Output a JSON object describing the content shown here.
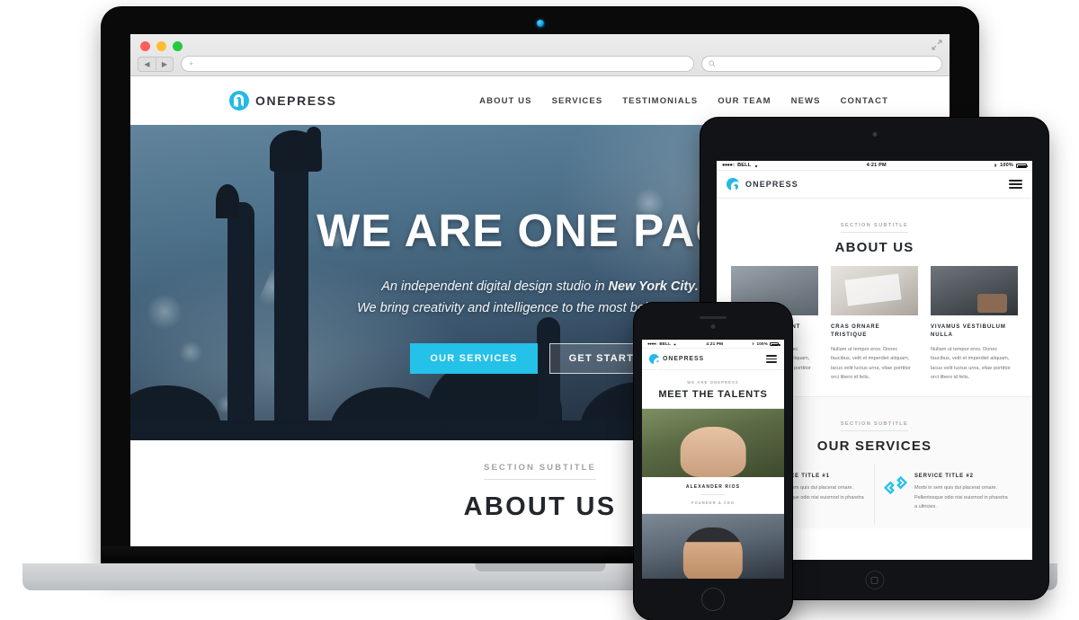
{
  "colors": {
    "brand_cyan": "#24b9e8",
    "button_cyan": "#24c1e8",
    "heading_dark": "#23272b",
    "muted_grey": "#a3a8ad"
  },
  "laptop": {
    "browser": {
      "back_icon": "◀",
      "forward_icon": "▶",
      "address_value": "+",
      "address_placeholder": "",
      "search_placeholder": "",
      "search_icon": "search-icon",
      "fullscreen_icon": "fullscreen-icon",
      "traffic_lights": [
        "close",
        "minimize",
        "zoom"
      ]
    },
    "site": {
      "brand": "ONEPRESS",
      "nav": [
        {
          "label": "ABOUT US"
        },
        {
          "label": "SERVICES"
        },
        {
          "label": "TESTIMONIALS"
        },
        {
          "label": "OUR TEAM"
        },
        {
          "label": "NEWS"
        },
        {
          "label": "CONTACT"
        }
      ],
      "hero": {
        "title": "WE ARE ONE PAGE",
        "subtitle_line1_plain": "An independent digital design studio in ",
        "subtitle_line1_bold": "New York City.",
        "subtitle_line2": "We bring creativity and intelligence to the most beloved brands.",
        "primary_button": "OUR SERVICES",
        "secondary_button": "GET STARTED"
      },
      "about": {
        "subtitle": "SECTION SUBTITLE",
        "title": "ABOUT US"
      }
    }
  },
  "tablet": {
    "status_bar": {
      "signal_dots": "●●●●○",
      "carrier": "BELL",
      "wifi_icon": "wifi-icon",
      "time": "4:21 PM",
      "bluetooth_icon": "bluetooth-icon",
      "battery_percent": "100%"
    },
    "header": {
      "brand": "ONEPRESS",
      "menu_icon": "hamburger-menu-icon"
    },
    "about": {
      "subtitle": "SECTION SUBTITLE",
      "title": "ABOUT US",
      "cards": [
        {
          "image": "city-street-photo",
          "title": "ALIQUAM TINCIDUNT AUCTOR",
          "body": "Nullam ut tempor eros. Donec faucibus, velit et imperdiet aliquam, lacus velit luctus urna, vitae porttitor orci libero id felis."
        },
        {
          "image": "desk-design-photo",
          "title": "CRAS ORNARE TRISTIQUE",
          "body": "Nullam ut tempor eros. Donec faucibus, velit et imperdiet aliquam, lacus velit luctus urna, vitae porttitor orci libero id felis."
        },
        {
          "image": "office-meeting-photo",
          "title": "VIVAMUS VESTIBULUM NULLA",
          "body": "Nullam ut tempor eros. Donec faucibus, velit et imperdiet aliquam, lacus velit luctus urna, vitae porttitor orci libero id felis."
        }
      ]
    },
    "services": {
      "subtitle": "SECTION SUBTITLE",
      "title": "OUR SERVICES",
      "items": [
        {
          "icon": "interlocking-squares-icon",
          "title": "SERVICE TITLE #1",
          "body": "Morbi in sem quis dui placerat ornare. Pellentesque odio nisi euismod in pharetra a ultricies."
        },
        {
          "icon": "interlocking-squares-icon",
          "title": "SERVICE TITLE #2",
          "body": "Morbi in sem quis dui placerat ornare. Pellentesque odio nisi euismod in pharetra a ultricies."
        }
      ]
    }
  },
  "phone": {
    "status_bar": {
      "signal_dots": "●●●●○",
      "carrier": "BELL",
      "wifi_icon": "wifi-icon",
      "time": "4:21 PM",
      "bluetooth_icon": "bluetooth-icon",
      "battery_percent": "100%"
    },
    "header": {
      "brand": "ONEPRESS",
      "menu_icon": "hamburger-menu-icon"
    },
    "team": {
      "subtitle": "WE ARE ONEPRESS",
      "title": "MEET THE TALENTS",
      "members": [
        {
          "photo": "portrait-alexander-rios",
          "name": "ALEXANDER RIOS",
          "role": "FOUNDER & CEO"
        },
        {
          "photo": "portrait-second-member",
          "name": "",
          "role": ""
        }
      ]
    }
  }
}
